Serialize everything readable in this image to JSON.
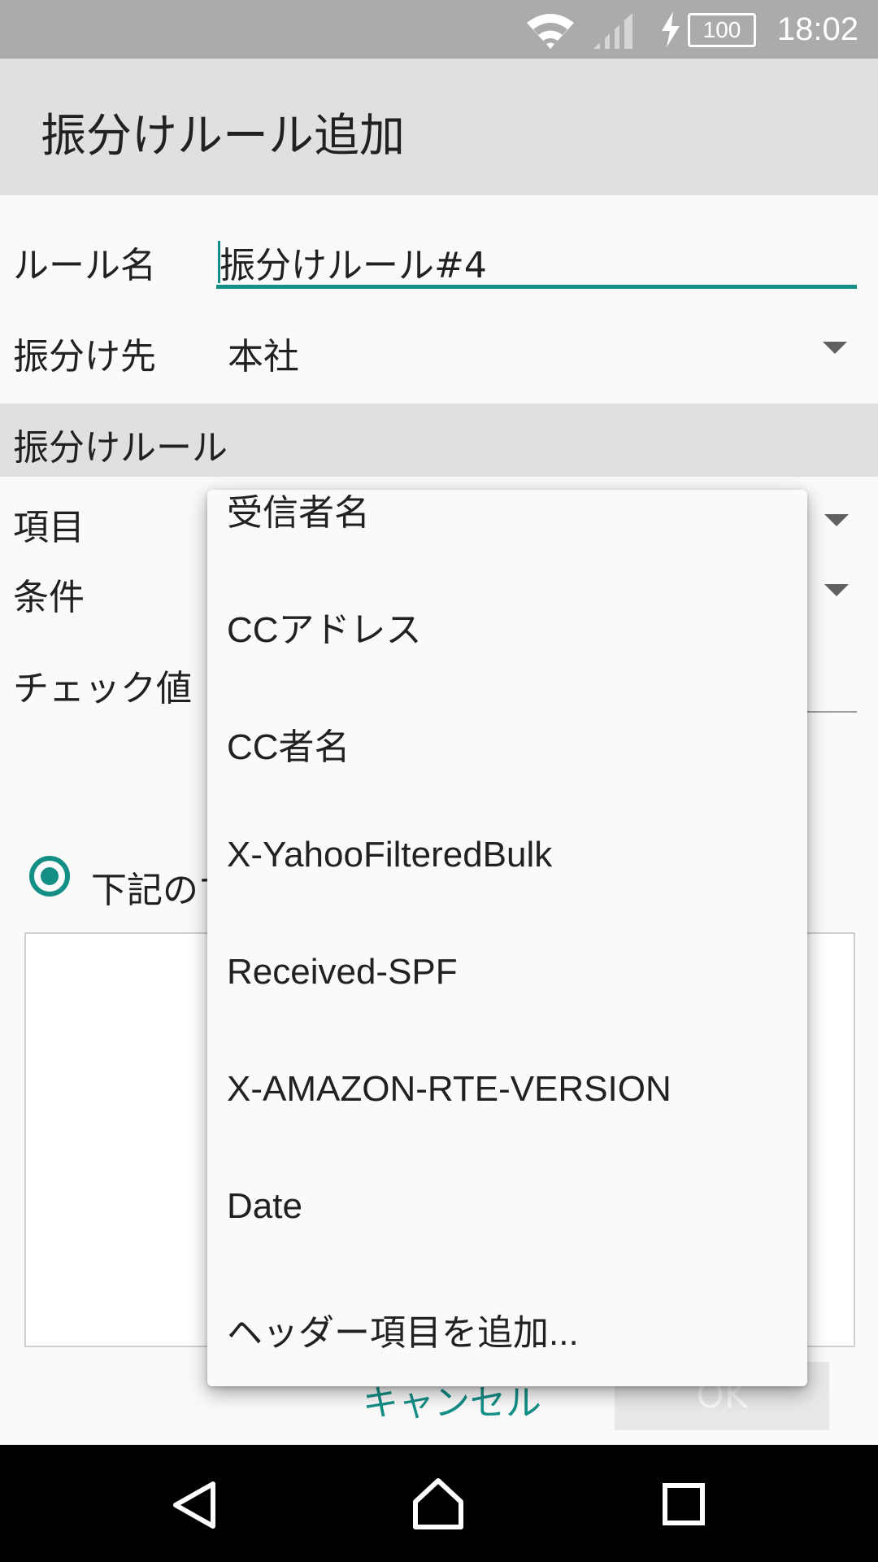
{
  "status_bar": {
    "time": "18:02",
    "battery": "100"
  },
  "app_bar": {
    "title": "振分けルール追加"
  },
  "form": {
    "rule_name_label": "ルール名",
    "rule_name_value": "振分けルール#4",
    "destination_label": "振分け先",
    "destination_value": "本社",
    "section_title": "振分けルール",
    "field_label": "項目",
    "condition_label": "条件",
    "check_value_label": "チェック値",
    "radio_label": "下記のす"
  },
  "buttons": {
    "cancel": "キャンセル",
    "ok": "OK"
  },
  "dropdown": {
    "items": [
      "受信者名",
      "CCアドレス",
      "CC者名",
      "X-YahooFilteredBulk",
      "Received-SPF",
      "X-AMAZON-RTE-VERSION",
      "Date",
      "ヘッダー項目を追加..."
    ]
  },
  "colors": {
    "accent": "#138f86",
    "app_bar": "#e0e0e0",
    "status_bar": "#ababab"
  },
  "icons": [
    "wifi-icon",
    "signal-icon",
    "charging-icon",
    "battery-icon",
    "back-icon",
    "home-icon",
    "recents-icon"
  ]
}
